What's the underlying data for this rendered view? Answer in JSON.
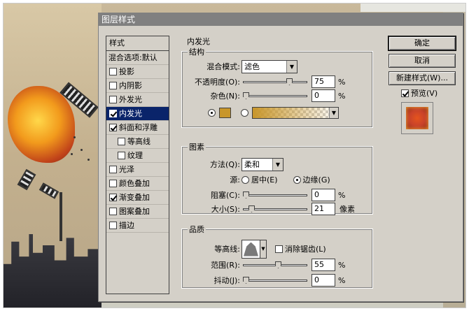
{
  "dialog": {
    "title": "图层样式"
  },
  "style_list": {
    "header": "样式",
    "blend_options": "混合选项:默认",
    "items": [
      {
        "label": "投影",
        "checked": false,
        "indent": false,
        "selected": false
      },
      {
        "label": "内阴影",
        "checked": false,
        "indent": false,
        "selected": false
      },
      {
        "label": "外发光",
        "checked": false,
        "indent": false,
        "selected": false
      },
      {
        "label": "内发光",
        "checked": true,
        "indent": false,
        "selected": true
      },
      {
        "label": "斜面和浮雕",
        "checked": true,
        "indent": false,
        "selected": false
      },
      {
        "label": "等高线",
        "checked": false,
        "indent": true,
        "selected": false
      },
      {
        "label": "纹理",
        "checked": false,
        "indent": true,
        "selected": false
      },
      {
        "label": "光泽",
        "checked": false,
        "indent": false,
        "selected": false
      },
      {
        "label": "颜色叠加",
        "checked": false,
        "indent": false,
        "selected": false
      },
      {
        "label": "渐变叠加",
        "checked": true,
        "indent": false,
        "selected": false
      },
      {
        "label": "图案叠加",
        "checked": false,
        "indent": false,
        "selected": false
      },
      {
        "label": "描边",
        "checked": false,
        "indent": false,
        "selected": false
      }
    ]
  },
  "inner_glow": {
    "title": "内发光",
    "structure": {
      "title": "结构",
      "blend_mode_label": "混合模式:",
      "blend_mode_value": "滤色",
      "opacity_label": "不透明度(O):",
      "opacity_value": "75",
      "opacity_unit": "%",
      "opacity_level": 0.75,
      "noise_label": "杂色(N):",
      "noise_value": "0",
      "noise_unit": "%",
      "noise_level": 0,
      "color_source": "solid",
      "glow_color": "#c8962a"
    },
    "elements": {
      "title": "图素",
      "method_label": "方法(Q):",
      "method_value": "柔和",
      "source_label": "源:",
      "source_center": "居中(E)",
      "source_edge": "边缘(G)",
      "source_selected": "edge",
      "choke_label": "阻塞(C):",
      "choke_value": "0",
      "choke_unit": "%",
      "choke_level": 0,
      "size_label": "大小(S):",
      "size_value": "21",
      "size_unit": "像素"
    },
    "quality": {
      "title": "品质",
      "contour_label": "等高线:",
      "antialias_label": "消除锯齿(L)",
      "antialias_checked": false,
      "range_label": "范围(R):",
      "range_value": "55",
      "range_unit": "%",
      "range_level": 0.55,
      "jitter_label": "抖动(J):",
      "jitter_value": "0",
      "jitter_unit": "%",
      "jitter_level": 0
    }
  },
  "buttons": {
    "ok": "确定",
    "cancel": "取消",
    "new_style": "新建样式(W)...",
    "preview_label": "预览(V)",
    "preview_checked": true
  },
  "icons": {
    "dropdown": "dropdown-arrow-icon",
    "contour_shape": "contour-curve-icon"
  }
}
